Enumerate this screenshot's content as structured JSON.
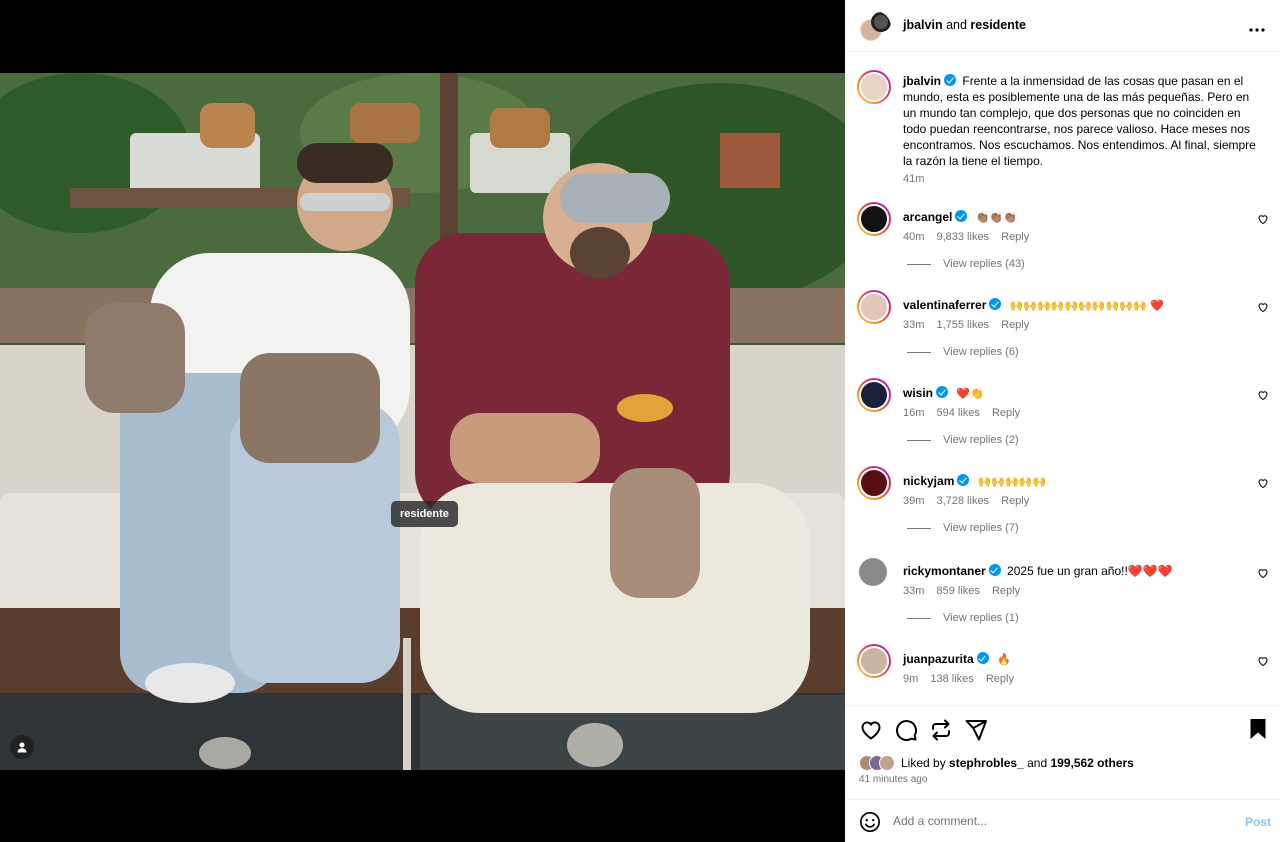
{
  "post": {
    "photo_tag": "residente",
    "header": {
      "user": "jbalvin",
      "connector": "and",
      "collab": "residente"
    },
    "caption": {
      "user": "jbalvin",
      "text": "Frente a la inmensidad de las cosas que pasan en el mundo, esta es posiblemente una de las más pequeñas. Pero en un mundo tan complejo, que dos personas que no coinciden en todo puedan reencontrarse, nos parece valioso. Hace meses nos encontramos. Nos escuchamos. Nos entendimos. Al final, siempre la razón la tiene el tiempo.",
      "time": "41m"
    },
    "comments": [
      {
        "user": "arcangel",
        "text": "👏🏽👏🏽👏🏽",
        "time": "40m",
        "likes": "9,833 likes",
        "reply": "Reply",
        "replies": "View replies (43)"
      },
      {
        "user": "valentinaferrer",
        "text": "🙌🙌🙌🙌🙌🙌🙌🙌🙌🙌 ❤️",
        "time": "33m",
        "likes": "1,755 likes",
        "reply": "Reply",
        "replies": "View replies (6)"
      },
      {
        "user": "wisin",
        "text": "❤️👏",
        "time": "16m",
        "likes": "594 likes",
        "reply": "Reply",
        "replies": "View replies (2)"
      },
      {
        "user": "nickyjam",
        "text": "🙌🙌🙌🙌🙌",
        "time": "39m",
        "likes": "3,728 likes",
        "reply": "Reply",
        "replies": "View replies (7)"
      },
      {
        "user": "rickymontaner",
        "text": "2025 fue un gran año!!❤️❤️❤️",
        "time": "33m",
        "likes": "859 likes",
        "reply": "Reply",
        "replies": "View replies (1)"
      },
      {
        "user": "juanpazurita",
        "text": "🔥",
        "time": "9m",
        "likes": "138 likes",
        "reply": "Reply"
      }
    ],
    "likes": {
      "prefix": "Liked by",
      "user": "stephrobles_",
      "middle": "and",
      "others": "199,562 others"
    },
    "posted": "41 minutes ago",
    "add_comment": {
      "placeholder": "Add a comment...",
      "post_label": "Post"
    },
    "icons": [
      "heart-icon",
      "comment-icon",
      "repost-icon",
      "share-icon",
      "save-icon",
      "emoji-icon",
      "more-icon"
    ]
  }
}
